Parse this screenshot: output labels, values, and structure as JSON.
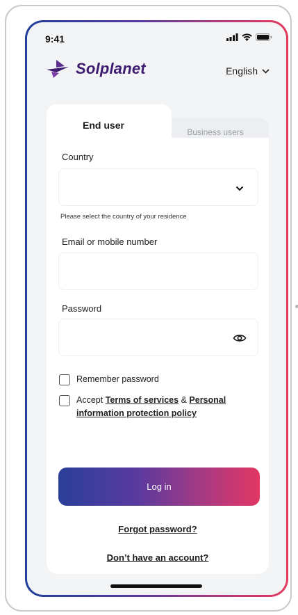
{
  "status_bar": {
    "time": "9:41",
    "icons": [
      "signal-icon",
      "wifi-icon",
      "battery-icon"
    ]
  },
  "header": {
    "brand": "Solplanet",
    "language": "English"
  },
  "tabs": [
    {
      "label": "End user",
      "active": true
    },
    {
      "label": "Business users",
      "active": false
    }
  ],
  "form": {
    "country": {
      "label": "Country",
      "value": "",
      "helper": "Please select the country of your residence"
    },
    "email": {
      "label": "Email or mobile number",
      "value": ""
    },
    "password": {
      "label": "Password",
      "value": ""
    },
    "remember": {
      "label": "Remember password",
      "checked": false
    },
    "accept": {
      "prefix": "Accept",
      "terms": "Terms of services",
      "amp": "&",
      "policy_1": "Personal",
      "policy_2": "information protection policy",
      "checked": false
    }
  },
  "buttons": {
    "login": "Log in"
  },
  "links": {
    "forgot": "Forgot password?",
    "signup": "Don’t have an account?"
  },
  "colors": {
    "brand": "#3d1b6f",
    "gradient_start": "#2a3f9a",
    "gradient_end": "#e23764"
  }
}
